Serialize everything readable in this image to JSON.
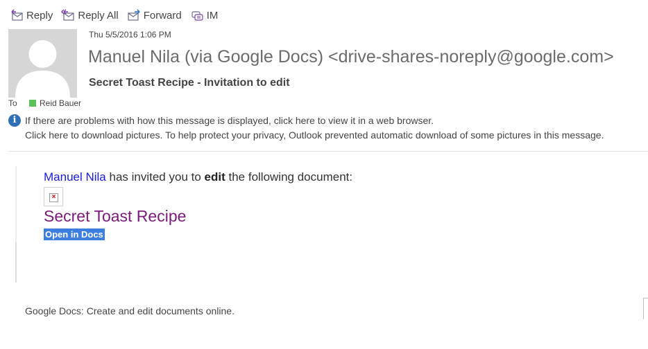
{
  "toolbar": {
    "reply": "Reply",
    "reply_all": "Reply All",
    "forward": "Forward",
    "im": "IM"
  },
  "header": {
    "date": "Thu 5/5/2016 1:06 PM",
    "sender": "Manuel Nila (via Google Docs) <drive-shares-noreply@google.com>",
    "subject": "Secret Toast Recipe - Invitation to edit",
    "to_label": "To",
    "recipient": "Reid Bauer"
  },
  "info": {
    "line1": "If there are problems with how this message is displayed, click here to view it in a web browser.",
    "line2": "Click here to download pictures. To help protect your privacy, Outlook prevented automatic download of some pictures in this message."
  },
  "message": {
    "inviter": "Manuel Nila",
    "text_before": " has invited you to ",
    "action": "edit",
    "text_after": " the following document:",
    "doc_title": "Secret Toast Recipe",
    "open_button": "Open in Docs",
    "footer": "Google Docs: Create and edit documents online."
  },
  "colors": {
    "presence": "#5ac05a",
    "link": "#1a1ad6",
    "doc_title": "#7a1a7a",
    "open_button": "#3c7fe0",
    "info_icon": "#2f6fb5"
  }
}
